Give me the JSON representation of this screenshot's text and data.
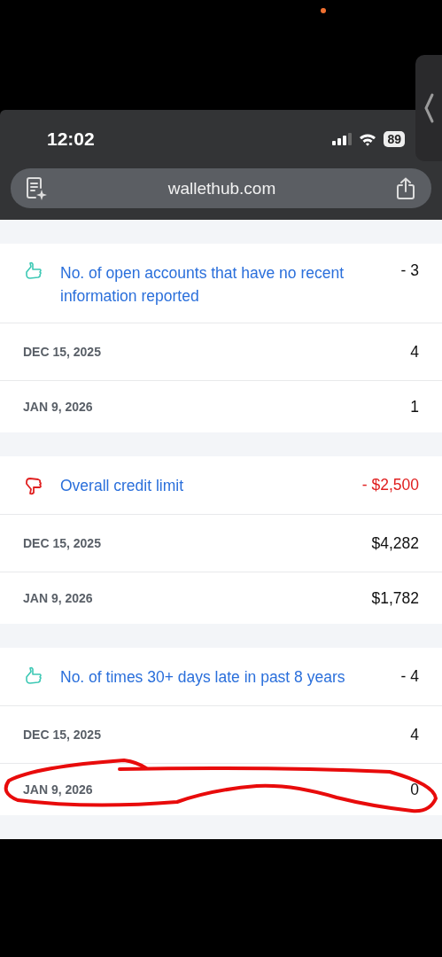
{
  "status_bar": {
    "time": "12:02",
    "battery": "89"
  },
  "address_bar": {
    "url": "wallethub.com"
  },
  "factors": [
    {
      "kind": "positive",
      "title": "No. of open accounts that have no recent information reported",
      "change": "- 3",
      "rows": [
        {
          "date": "DEC 15, 2025",
          "value": "4"
        },
        {
          "date": "JAN 9, 2026",
          "value": "1"
        }
      ]
    },
    {
      "kind": "negative",
      "title": "Overall credit limit",
      "change": "- $2,500",
      "rows": [
        {
          "date": "DEC 15, 2025",
          "value": "$4,282"
        },
        {
          "date": "JAN 9, 2026",
          "value": "$1,782"
        }
      ]
    },
    {
      "kind": "positive",
      "title": "No. of times 30+ days late in past 8 years",
      "change": "- 4",
      "rows": [
        {
          "date": "DEC 15, 2025",
          "value": "4"
        },
        {
          "date": "JAN 9, 2026",
          "value": "0"
        }
      ]
    }
  ]
}
